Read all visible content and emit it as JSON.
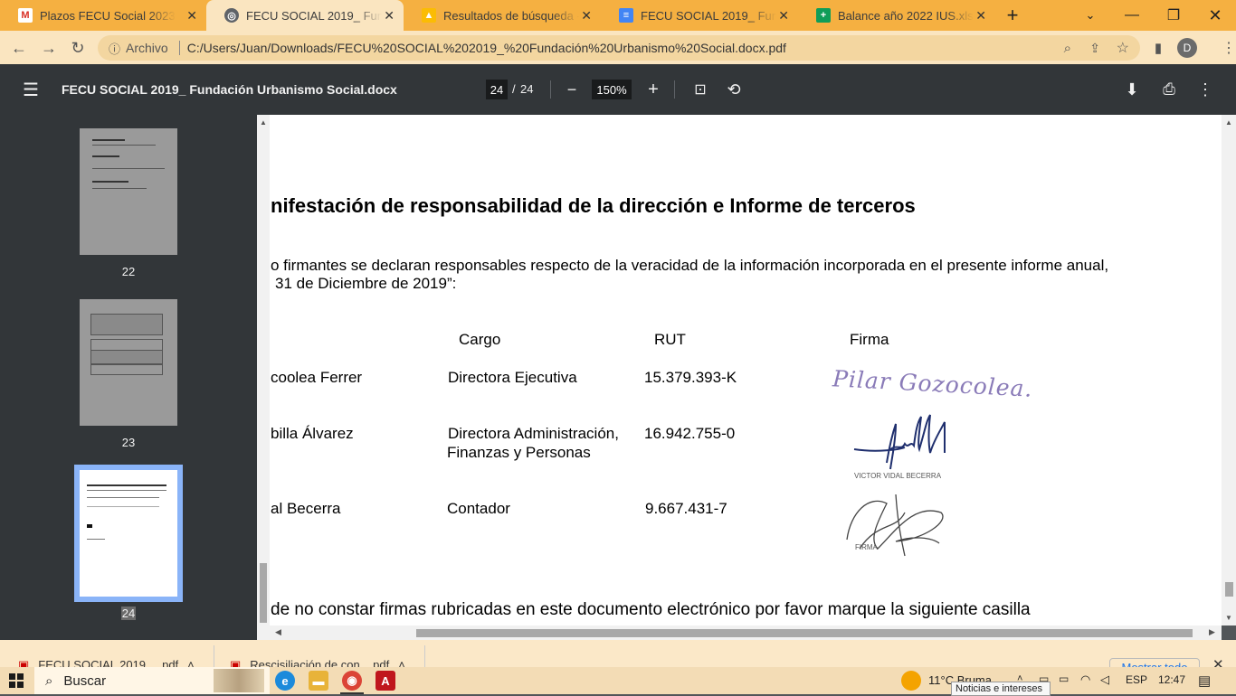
{
  "tabs": [
    {
      "icon": "gmail-icon",
      "title": "Plazos FECU Social 2023 - da"
    },
    {
      "icon": "globe-icon",
      "title": "FECU SOCIAL 2019_ Fundació"
    },
    {
      "icon": "google-drive-icon",
      "title": "Resultados de búsqueda - Go"
    },
    {
      "icon": "google-docs-icon",
      "title": "FECU SOCIAL 2019_ Fundació"
    },
    {
      "icon": "google-sheets-icon",
      "title": "Balance año 2022 IUS.xlsx - H"
    }
  ],
  "omnibox": {
    "label": "Archivo",
    "url": "C:/Users/Juan/Downloads/FECU%20SOCIAL%202019_%20Fundación%20Urbanismo%20Social.docx.pdf",
    "profile_initial": "D"
  },
  "pdf_toolbar": {
    "title": "FECU SOCIAL 2019_ Fundación Urbanismo Social.docx",
    "current_page": "24",
    "page_separator": "/",
    "total_pages": "24",
    "zoom": "150%"
  },
  "sidebar": {
    "thumbnails": [
      {
        "label": "22"
      },
      {
        "label": "23"
      },
      {
        "label": "24"
      }
    ]
  },
  "document": {
    "heading": "nifestación de responsabilidad de la dirección e Informe de terceros",
    "para_line1": "o firmantes se declaran responsables respecto de la veracidad de la información incorporada en el presente informe anual,",
    "para_line2": "31 de Diciembre de 2019”:",
    "columns": {
      "cargo": "Cargo",
      "rut": "RUT",
      "firma": "Firma"
    },
    "rows": [
      {
        "name": "coolea Ferrer",
        "cargo_line1": "Directora Ejecutiva",
        "cargo_line2": "",
        "rut": "15.379.393-K",
        "signature_text": "Pilar Gozocolea."
      },
      {
        "name": "billa Álvarez",
        "cargo_line1": "Directora Administración,",
        "cargo_line2": "Finanzas y Personas",
        "rut": "16.942.755-0",
        "signature_caption": "VICTOR VIDAL BECERRA"
      },
      {
        "name": "al Becerra",
        "cargo_line1": "Contador",
        "cargo_line2": "",
        "rut": "9.667.431-7",
        "signature_caption": "FIRMA"
      }
    ],
    "footer_line": "de no constar firmas rubricadas en este documento electrónico por favor marque la siguiente casilla"
  },
  "downloads": {
    "items": [
      "FECU SOCIAL 2019_...pdf",
      "Rescisiliación de con....pdf"
    ],
    "show_all": "Mostrar todo"
  },
  "taskbar": {
    "search_placeholder": "Buscar",
    "weather": "11°C  Bruma",
    "language": "ESP",
    "time": "12:47",
    "tooltip": "Noticias e intereses"
  },
  "colors": {
    "accent": "#f5b041",
    "pdf_toolbar": "#323639",
    "selected_thumb": "#8ab4f8"
  }
}
